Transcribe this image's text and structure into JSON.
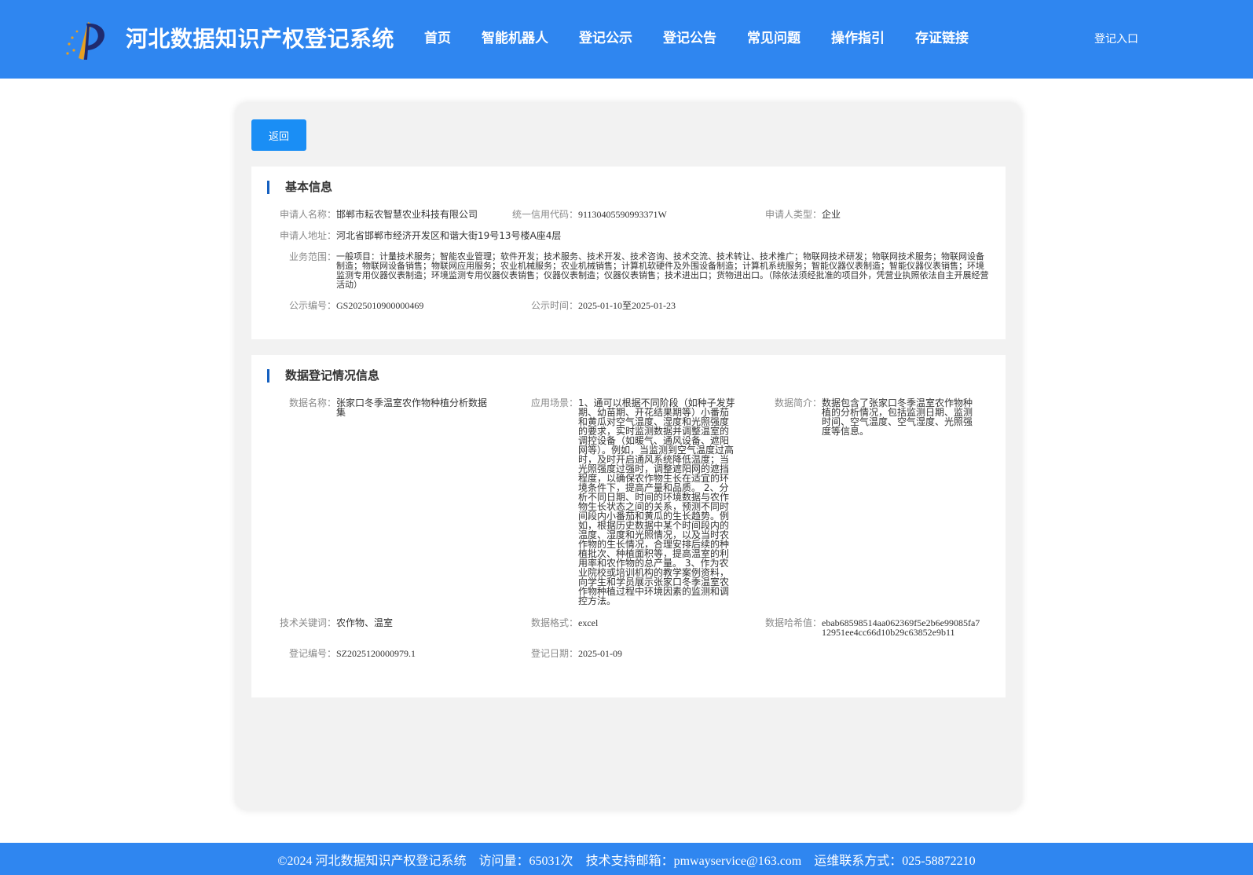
{
  "header": {
    "title": "河北数据知识产权登记系统",
    "nav": [
      "首页",
      "智能机器人",
      "登记公示",
      "登记公告",
      "常见问题",
      "操作指引",
      "存证链接"
    ],
    "login": "登记入口"
  },
  "back_label": "返回",
  "basic": {
    "title": "基本信息",
    "applicant_name": {
      "label": "申请人名称：",
      "value": "邯郸市耘农智慧农业科技有限公司"
    },
    "credit_code": {
      "label": "统一信用代码：",
      "value": "91130405590993371W"
    },
    "applicant_type": {
      "label": "申请人类型：",
      "value": "企业"
    },
    "address": {
      "label": "申请人地址：",
      "value": "河北省邯郸市经济开发区和谐大街19号13号楼A座4层"
    },
    "scope": {
      "label": "业务范围：",
      "value": "一般项目：计量技术服务；智能农业管理；软件开发；技术服务、技术开发、技术咨询、技术交流、技术转让、技术推广；物联网技术研发；物联网技术服务；物联网设备制造；物联网设备销售；物联网应用服务；农业机械服务；农业机械销售；计算机软硬件及外围设备制造；计算机系统服务；智能仪器仪表制造；智能仪器仪表销售；环境监测专用仪器仪表制造；环境监测专用仪器仪表销售；仪器仪表制造；仪器仪表销售；技术进出口；货物进出口。（除依法须经批准的项目外，凭营业执照依法自主开展经营活动）"
    },
    "public_no": {
      "label": "公示编号：",
      "value": "GS2025010900000469"
    },
    "public_time": {
      "label": "公示时间：",
      "value": "2025-01-10至2025-01-23"
    }
  },
  "registration": {
    "title": "数据登记情况信息",
    "data_name": {
      "label": "数据名称：",
      "value": "张家口冬季温室农作物种植分析数据集"
    },
    "scenario": {
      "label": "应用场景：",
      "value": "1、通可以根据不同阶段（如种子发芽期、幼苗期、开花结果期等）小番茄和黄瓜对空气温度、湿度和光照强度的要求，实时监测数据并调整温室的调控设备（如暖气、通风设备、遮阳网等）。例如，当监测到空气温度过高时，及时开启通风系统降低温度；当光照强度过强时，调整遮阳网的遮挡程度，以确保农作物生长在适宜的环境条件下，提高产量和品质。 2、分析不同日期、时间的环境数据与农作物生长状态之间的关系，预测不同时间段内小番茄和黄瓜的生长趋势。例如，根据历史数据中某个时间段内的温度、湿度和光照情况，以及当时农作物的生长情况，合理安排后续的种植批次、种植面积等，提高温室的利用率和农作物的总产量。 3、作为农业院校或培训机构的教学案例资料，向学生和学员展示张家口冬季温室农作物种植过程中环境因素的监测和调控方法。"
    },
    "summary": {
      "label": "数据简介：",
      "value": "数据包含了张家口冬季温室农作物种植的分析情况，包括监测日期、监测时间、空气温度、空气湿度、光照强度等信息。"
    },
    "keywords": {
      "label": "技术关键词：",
      "value": "农作物、温室"
    },
    "format": {
      "label": "数据格式：",
      "value": "excel"
    },
    "hash": {
      "label": "数据哈希值：",
      "value": "ebab68598514aa062369f5e2b6e99085fa712951ee4cc66d10b29c63852e9b11"
    },
    "reg_no": {
      "label": "登记编号：",
      "value": "SZ2025120000979.1"
    },
    "reg_date": {
      "label": "登记日期：",
      "value": "2025-01-09"
    }
  },
  "footer": {
    "copyright": "©2024 河北数据知识产权登记系统",
    "visits": "访问量：65031次",
    "email": "技术支持邮箱：pmwayservice@163.com",
    "contact": "运维联系方式：025-58872210"
  },
  "colors": {
    "primary": "#2f86f0",
    "button": "#1a8ef5",
    "accent_bar": "#1560c0"
  }
}
